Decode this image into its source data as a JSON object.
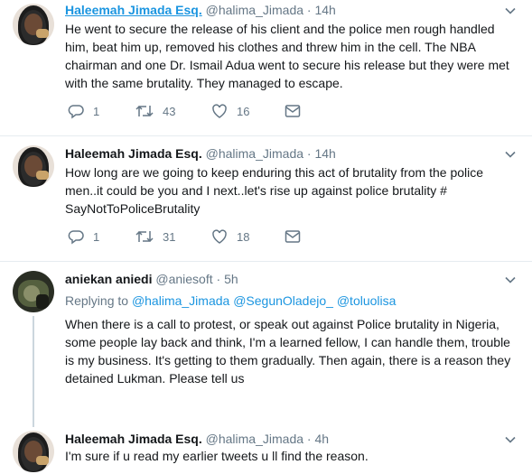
{
  "tweets": [
    {
      "name": "Haleemah Jimada Esq.",
      "handle": "@halima_Jimada",
      "time": "14h",
      "text": "He went to secure the release of his client and the police men  rough handled him, beat him up, removed his clothes and threw him in the cell. The NBA chairman and one Dr. Ismail Adua went to secure his release but they were met with the same brutality. They managed to escape.",
      "replies": "1",
      "retweets": "43",
      "likes": "16"
    },
    {
      "name": "Haleemah Jimada Esq.",
      "handle": "@halima_Jimada",
      "time": "14h",
      "text": "How long are we going to keep enduring this act of brutality from the police men..it could be you and I next..let's rise up against police brutality # SayNotToPoliceBrutality",
      "replies": "1",
      "retweets": "31",
      "likes": "18"
    },
    {
      "name": "aniekan aniedi",
      "handle": "@aniesoft",
      "time": "5h",
      "replying_label": "Replying to",
      "mentions": [
        "@halima_Jimada",
        "@SegunOladejo_",
        "@toluolisa"
      ],
      "text": "When there is a call to protest, or speak out against Police brutality in Nigeria, some people lay back and think, I'm a learned fellow, I can handle them, trouble is my business. It's getting to them gradually. Then again, there is a reason they detained Lukman. Please tell us"
    },
    {
      "name": "Haleemah Jimada Esq.",
      "handle": "@halima_Jimada",
      "time": "4h",
      "text": "I'm sure if u read my earlier tweets u ll find the reason."
    }
  ],
  "separator": "·",
  "colors": {
    "accent": "#1b95e0",
    "muted": "#657786",
    "text": "#14171a",
    "border": "#e6ecf0"
  },
  "icons": [
    "reply-icon",
    "retweet-icon",
    "like-icon",
    "direct-message-icon",
    "chevron-down-icon"
  ]
}
